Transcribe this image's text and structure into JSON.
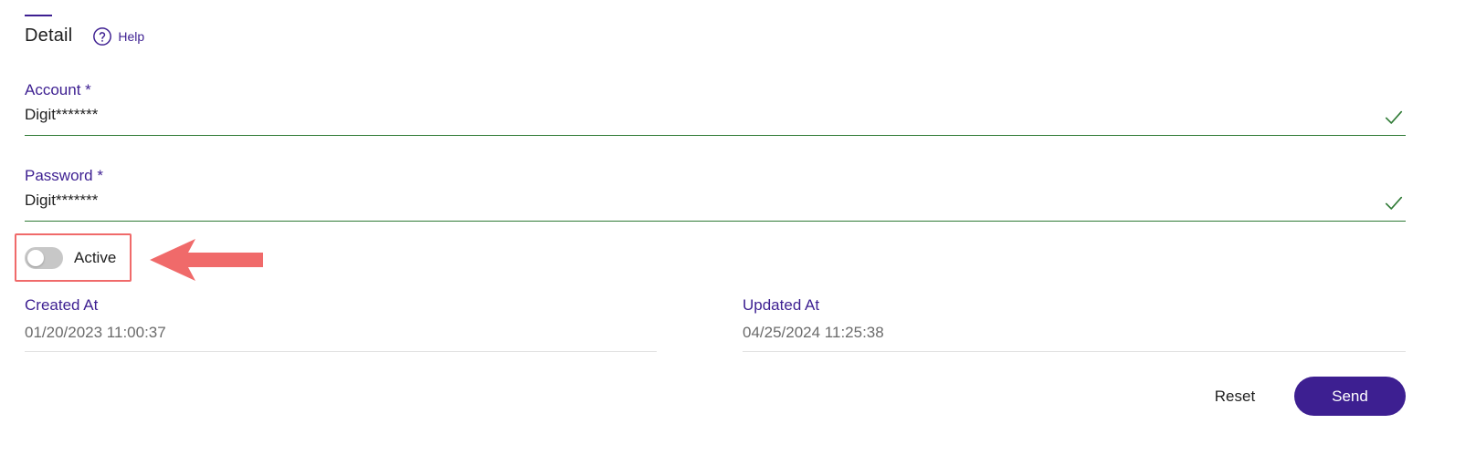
{
  "header": {
    "title": "Detail",
    "help_label": "Help"
  },
  "form": {
    "account": {
      "label": "Account *",
      "value": "Digit*******",
      "valid": true
    },
    "password": {
      "label": "Password *",
      "value": "Digit*******",
      "valid": true
    },
    "active_toggle": {
      "label": "Active",
      "checked": false
    }
  },
  "meta": {
    "created_label": "Created At",
    "created_value": "01/20/2023 11:00:37",
    "updated_label": "Updated At",
    "updated_value": "04/25/2024 11:25:38"
  },
  "actions": {
    "reset_label": "Reset",
    "send_label": "Send"
  },
  "annotation": {
    "highlight_color": "#f06a6a",
    "arrow_color": "#f06a6a"
  },
  "colors": {
    "accent": "#3d1f91",
    "valid": "#2f7a35"
  },
  "icons": {
    "help": "question-circle-icon",
    "valid": "check-icon",
    "annotation": "arrow-left-icon"
  }
}
